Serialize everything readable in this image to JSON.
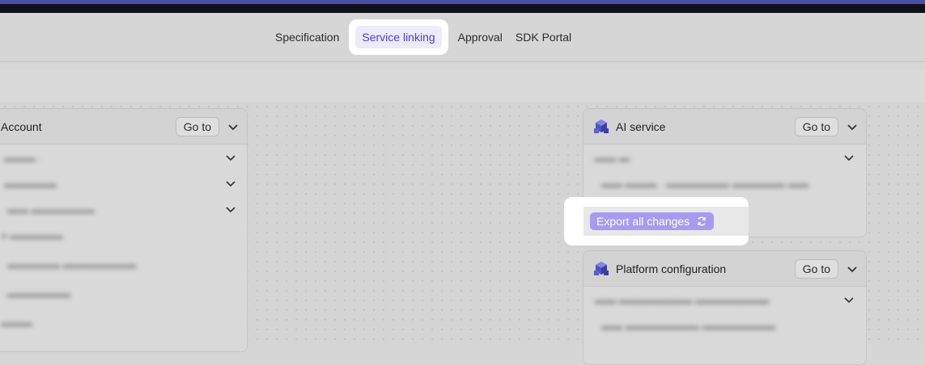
{
  "nav": {
    "tabs": [
      {
        "label": "Specification"
      },
      {
        "label": "Service linking"
      },
      {
        "label": "Approval"
      },
      {
        "label": "SDK Portal"
      }
    ],
    "active_index": 1
  },
  "cards": {
    "account": {
      "title": "Account",
      "goto_label": "Go to"
    },
    "ai_service": {
      "title": "AI service",
      "goto_label": "Go to",
      "footer_button": "Export all changes"
    },
    "platform": {
      "title": "Platform configuration",
      "goto_label": "Go to"
    }
  },
  "colors": {
    "accent": "#4a3fd0",
    "export_button": "#a79af2"
  }
}
